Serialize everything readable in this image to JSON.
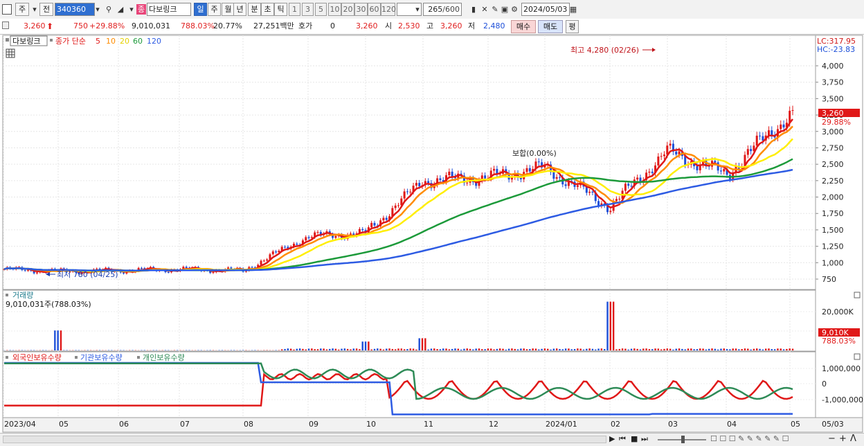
{
  "toolbar": {
    "market_select": "주",
    "prev_label": "전",
    "code": "340360",
    "name_badge": "종",
    "name": "다보링크",
    "periods": [
      "일",
      "주",
      "월",
      "년",
      "분",
      "초",
      "틱"
    ],
    "selected_period": "일",
    "intervals": [
      "1",
      "3",
      "5",
      "10",
      "20",
      "30",
      "60",
      "120"
    ],
    "count": "265",
    "count_total": "/600",
    "date": "2024/05/03"
  },
  "quote": {
    "price": "3,260",
    "change": "750",
    "change_pct": "+29.88%",
    "volume": "9,010,031",
    "vol_ratio": "788.03%",
    "turnover": "20.77%",
    "amount": "27,251백만",
    "hoga_label": "호가",
    "hoga_value": "0",
    "hoga_price": "3,260",
    "open_label": "시",
    "open": "2,530",
    "high_label": "고",
    "high": "3,260",
    "low_label": "저",
    "low": "2,480",
    "buy_label": "매수",
    "sell_label": "매도",
    "eval_label": "평"
  },
  "price_pane": {
    "name_tag": "다보링크",
    "ma_label": "종가 단순",
    "ma_periods": [
      "5",
      "10",
      "20",
      "60",
      "120"
    ],
    "ma_colors": [
      "#e01818",
      "#ff8c00",
      "#ffee00",
      "#1c9a3a",
      "#2d5be3"
    ],
    "lc": "LC:317.95",
    "hc": "HC:-23.83",
    "high_note": "최고 4,280 (02/26)",
    "low_note": "최저 780 (04/25)",
    "mid_note": "보합(0.00%)",
    "price_tag": "3,260",
    "price_tag_pct": "29.88%",
    "y_ticks": [
      "4,000",
      "3,750",
      "3,500",
      "3,250",
      "3,000",
      "2,750",
      "2,500",
      "2,250",
      "2,000",
      "1,750",
      "1,500",
      "1,250",
      "1,000",
      "750"
    ]
  },
  "volume_pane": {
    "title": "거래량",
    "value": "9,010,031주(788.03%)",
    "y_ticks": [
      "20,000K",
      "10,000K"
    ],
    "tag": "9,010K",
    "tag_pct": "788.03%"
  },
  "holding_pane": {
    "legend": [
      "외국인보유수량",
      "기관보유수량",
      "개인보유수량"
    ],
    "colors": [
      "#e01818",
      "#2d5be3",
      "#2e8b57"
    ],
    "y_ticks": [
      "1,000,000",
      "0",
      "-1,000,000"
    ]
  },
  "x_axis": {
    "labels": [
      "2023/04",
      "05",
      "06",
      "07",
      "08",
      "09",
      "10",
      "11",
      "12",
      "2024/01",
      "02",
      "03",
      "04",
      "05"
    ],
    "last_label": "05/03"
  },
  "chart_data": {
    "type": "line",
    "price_ylim": [
      600,
      4300
    ],
    "close_by_period": [
      {
        "x": "2023/04",
        "close": 900
      },
      {
        "x": "05",
        "close": 870
      },
      {
        "x": "06",
        "close": 880
      },
      {
        "x": "07",
        "close": 900
      },
      {
        "x": "08",
        "close": 880
      },
      {
        "x": "09",
        "close": 1400
      },
      {
        "x": "10",
        "close": 1450
      },
      {
        "x": "11",
        "close": 2250
      },
      {
        "x": "12",
        "close": 2300
      },
      {
        "x": "2024/01",
        "close": 2450
      },
      {
        "x": "02",
        "close": 1850
      },
      {
        "x": "03",
        "close": 2700
      },
      {
        "x": "04",
        "close": 2350
      },
      {
        "x": "05",
        "close": 3260
      }
    ],
    "volume_peaks_k": [
      {
        "x": "10",
        "value": 4000
      },
      {
        "x": "11",
        "value": 5500
      },
      {
        "x": "02",
        "value": 22000
      },
      {
        "x": "05",
        "value": 9010
      }
    ]
  }
}
